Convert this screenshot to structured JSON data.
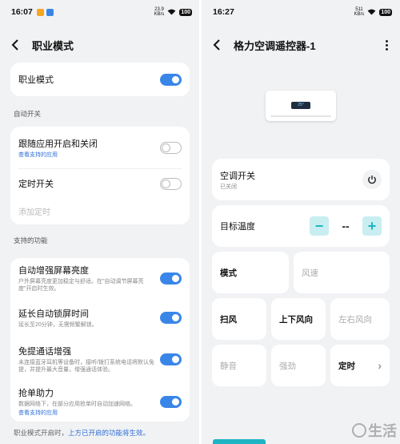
{
  "left": {
    "status": {
      "time": "16:07",
      "speed_top": "23.9",
      "speed_bottom": "KB/s",
      "battery": "100"
    },
    "header": {
      "title": "职业模式"
    },
    "pro_mode": {
      "label": "职业模式",
      "on": true
    },
    "auto_switch": {
      "section": "自动开关",
      "follow_app": {
        "label": "跟随应用开启和关闭",
        "link": "查看支持的应用",
        "on": false
      },
      "timer": {
        "label": "定时开关",
        "on": false
      },
      "add_timer": "添加定时"
    },
    "supported": {
      "section": "支持的功能",
      "items": [
        {
          "label": "自动增强屏幕亮度",
          "desc": "户外屏幕亮度更加稳定与舒适。在\"自动调节屏幕亮度\"开启时生效。",
          "link": "",
          "on": true
        },
        {
          "label": "延长自动锁屏时间",
          "desc": "延长至20分钟，无需频繁解锁。",
          "link": "",
          "on": true
        },
        {
          "label": "免提通话增强",
          "desc": "未连接蓝牙耳机等设备时，接听/拨打系统电话将默认免提，并提升最大音量，增强通话体验。",
          "link": "",
          "on": true
        },
        {
          "label": "抢单助力",
          "desc": "数据网络下，在部分应用抢单时自动加速网络。",
          "link": "查看支持的应用",
          "on": true
        }
      ]
    },
    "footer": {
      "prefix": "职业模式开启时，",
      "highlight": "上方已开启的功能将生效。"
    }
  },
  "right": {
    "status": {
      "time": "16:27",
      "speed_top": "511",
      "speed_bottom": "KB/s",
      "battery": "100"
    },
    "header": {
      "title": "格力空调遥控器-1"
    },
    "ac_display": "25°",
    "power": {
      "label": "空调开关",
      "state": "已关闭"
    },
    "temp": {
      "label": "目标温度",
      "minus": "−",
      "value": "--",
      "plus": "+"
    },
    "tiles_row1": [
      "模式",
      "风速"
    ],
    "tiles_row2": [
      "扫风",
      "上下风向",
      "左右风向"
    ],
    "tiles_row3": [
      "静音",
      "强劲",
      "定时"
    ],
    "chevron": "›",
    "watermark": "生活"
  },
  "colors": {
    "accent": "#3a86e8",
    "teal": "#1db4c4",
    "link": "#2f6fd6"
  }
}
